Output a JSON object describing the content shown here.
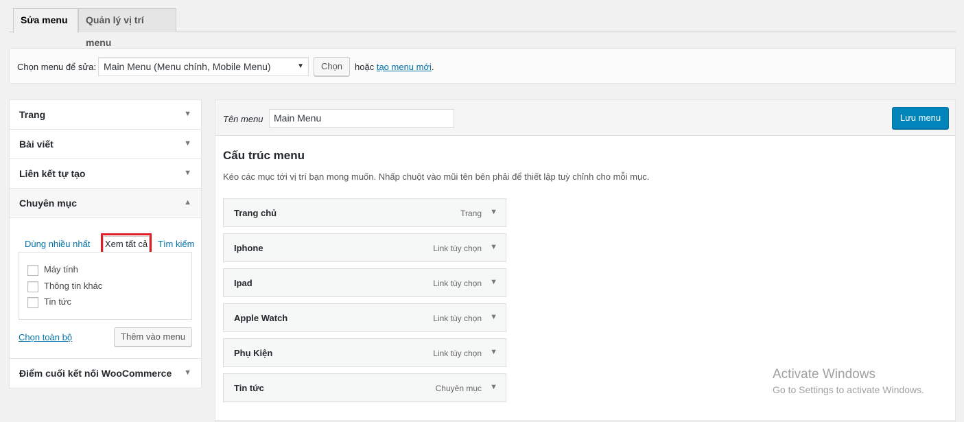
{
  "tabs": [
    {
      "label": "Sửa menu",
      "active": true
    },
    {
      "label": "Quản lý vị trí menu",
      "active": false
    }
  ],
  "select_bar": {
    "label": "Chọn menu để sửa:",
    "selected": "Main Menu (Menu chính, Mobile Menu)",
    "choose_button": "Chọn",
    "or_text": "hoặc",
    "new_menu_link": "tạo menu mới",
    "period": "."
  },
  "accordion": {
    "sections": [
      {
        "title": "Trang"
      },
      {
        "title": "Bài viết"
      },
      {
        "title": "Liên kết tự tạo"
      },
      {
        "title": "Chuyên mục"
      },
      {
        "title": "Điểm cuối kết nối WooCommerce"
      }
    ],
    "category_tabs": [
      "Dùng nhiều nhất",
      "Xem tất cả",
      "Tìm kiếm"
    ],
    "category_items": [
      "Máy tính",
      "Thông tin khác",
      "Tin tức"
    ],
    "select_all": "Chọn toàn bộ",
    "add_button": "Thêm vào menu"
  },
  "editor": {
    "name_label": "Tên menu",
    "name_value": "Main Menu",
    "save_button": "Lưu menu",
    "structure_title": "Cấu trúc menu",
    "structure_desc": "Kéo các mục tới vị trí bạn mong muốn. Nhấp chuột vào mũi tên bên phải để thiết lập tuỳ chỉnh cho mỗi mục.",
    "items": [
      {
        "name": "Trang chủ",
        "type": "Trang"
      },
      {
        "name": "Iphone",
        "type": "Link tùy chọn"
      },
      {
        "name": "Ipad",
        "type": "Link tùy chọn"
      },
      {
        "name": "Apple Watch",
        "type": "Link tùy chọn"
      },
      {
        "name": "Phụ Kiện",
        "type": "Link tùy chọn"
      },
      {
        "name": "Tin tức",
        "type": "Chuyên mục"
      }
    ]
  },
  "watermark": {
    "line1": "Activate Windows",
    "line2": "Go to Settings to activate Windows."
  },
  "icons": {
    "caret_down": "▼",
    "caret_up": "▲"
  },
  "colors": {
    "link": "#0073aa",
    "primary_button": "#0085ba",
    "highlight_box": "#e01e25"
  }
}
